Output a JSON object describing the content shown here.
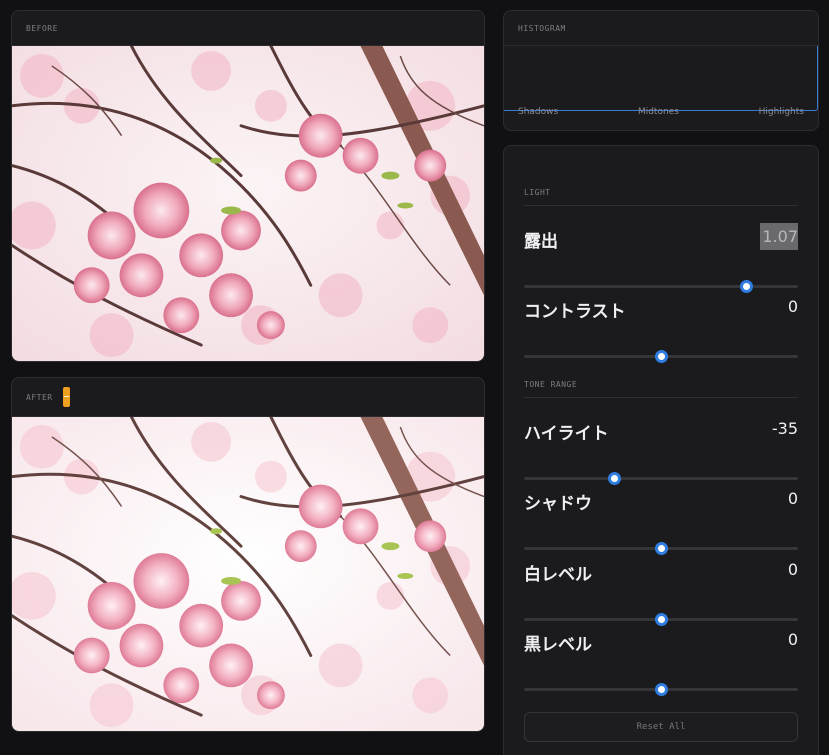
{
  "before": {
    "label": "BEFORE"
  },
  "after": {
    "label": "AFTER"
  },
  "histogram": {
    "label": "HISTOGRAM",
    "shadows": "Shadows",
    "midtones": "Midtones",
    "highlights": "Highlights"
  },
  "light": {
    "title": "LIGHT",
    "exposure": {
      "label": "露出",
      "value": "1.07",
      "level": 0.81
    },
    "contrast": {
      "label": "コントラスト",
      "value": "0",
      "level": 0.5
    }
  },
  "tone": {
    "title": "TONE RANGE",
    "highlights": {
      "label": "ハイライト",
      "value": "-35",
      "level": 0.33
    },
    "shadows": {
      "label": "シャドウ",
      "value": "0",
      "level": 0.5
    },
    "whites": {
      "label": "白レベル",
      "value": "0",
      "level": 0.5
    },
    "blacks": {
      "label": "黒レベル",
      "value": "0",
      "level": 0.5
    }
  },
  "reset_label": "Reset All",
  "colors": {
    "accent": "#2f7de1",
    "badge": "#f0a020",
    "blossom": "#e8899f"
  }
}
